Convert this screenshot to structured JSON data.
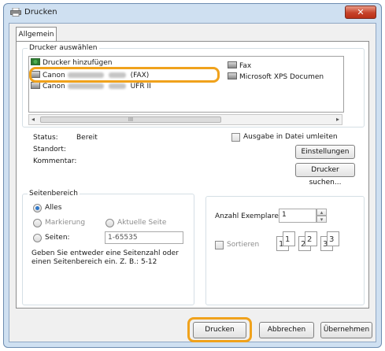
{
  "window": {
    "title": "Drucken",
    "close": "✕"
  },
  "tab": {
    "label": "Allgemein"
  },
  "printer_select": {
    "legend": "Drucker auswählen",
    "items": [
      {
        "name": "Drucker hinzufügen",
        "icon": "add-printer-icon"
      },
      {
        "name_prefix": "Canon",
        "name_suffix": "(FAX)",
        "icon": "printer-icon",
        "selected": true
      },
      {
        "name_prefix": "Canon",
        "name_suffix": "UFR II",
        "icon": "printer-icon"
      },
      {
        "name": "Fax",
        "icon": "fax-icon"
      },
      {
        "name": "Microsoft XPS Documen",
        "icon": "printer-icon"
      }
    ],
    "scroll_thumb": "III"
  },
  "status": {
    "status_label": "Status:",
    "status_value": "Bereit",
    "location_label": "Standort:",
    "comment_label": "Kommentar:",
    "print_to_file": "Ausgabe in Datei umleiten",
    "preferences_button": "Einstellungen",
    "find_printer_button": "Drucker suchen..."
  },
  "page_range": {
    "legend": "Seitenbereich",
    "all": "Alles",
    "selection": "Markierung",
    "current_page": "Aktuelle Seite",
    "pages": "Seiten:",
    "pages_value": "1-65535",
    "hint": "Geben Sie entweder eine Seitenzahl oder einen Seitenbereich ein. Z. B.: 5-12"
  },
  "copies": {
    "label": "Anzahl Exemplare:",
    "value": "1",
    "collate": "Sortieren",
    "collate_sheets": [
      "1",
      "1",
      "2",
      "2",
      "3",
      "3"
    ]
  },
  "footer": {
    "print_button": "Drucken",
    "cancel_button": "Abbrechen",
    "apply_button": "Übernehmen"
  },
  "colors": {
    "highlight": "#f0a21c",
    "titlebar": "#cfe0f1",
    "close": "#c7432a"
  }
}
